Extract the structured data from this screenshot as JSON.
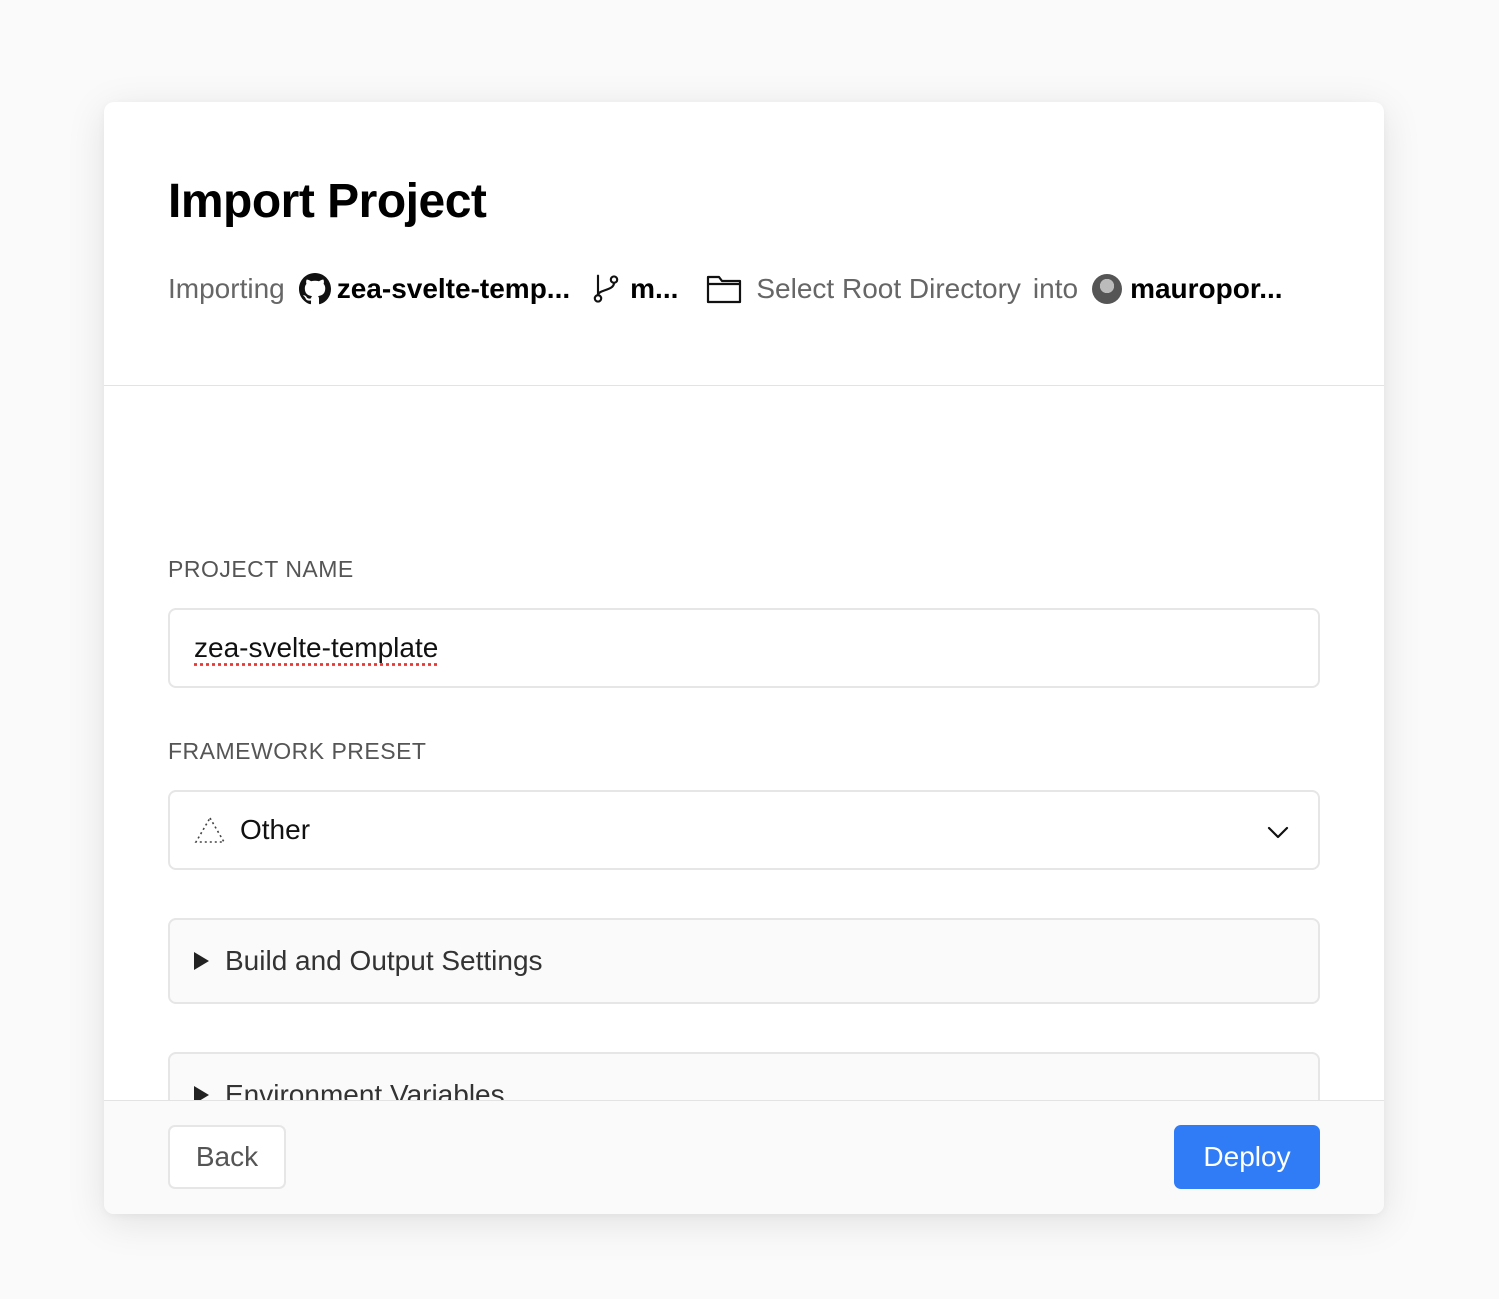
{
  "header": {
    "title": "Import Project",
    "importing_label": "Importing",
    "repo_name": "zea-svelte-temp...",
    "branch_name": "m...",
    "root_directory_label": "Select Root Directory",
    "into_label": "into",
    "account_name": "mauropor..."
  },
  "form": {
    "project_name_label": "PROJECT NAME",
    "project_name_value": "zea-svelte-template",
    "framework_label": "FRAMEWORK PRESET",
    "framework_value": "Other"
  },
  "sections": {
    "build_settings": "Build and Output Settings",
    "env_variables": "Environment Variables"
  },
  "footer": {
    "back_label": "Back",
    "deploy_label": "Deploy"
  },
  "icons": {
    "repo": "github-icon",
    "branch": "git-branch-icon",
    "folder": "folder-icon",
    "framework": "triangle-outline-icon",
    "dropdown": "chevron-down-icon",
    "expand": "triangle-right-icon"
  },
  "colors": {
    "primary": "#2f7cf6",
    "background": "#fafafa",
    "border": "#e6e6e6"
  }
}
